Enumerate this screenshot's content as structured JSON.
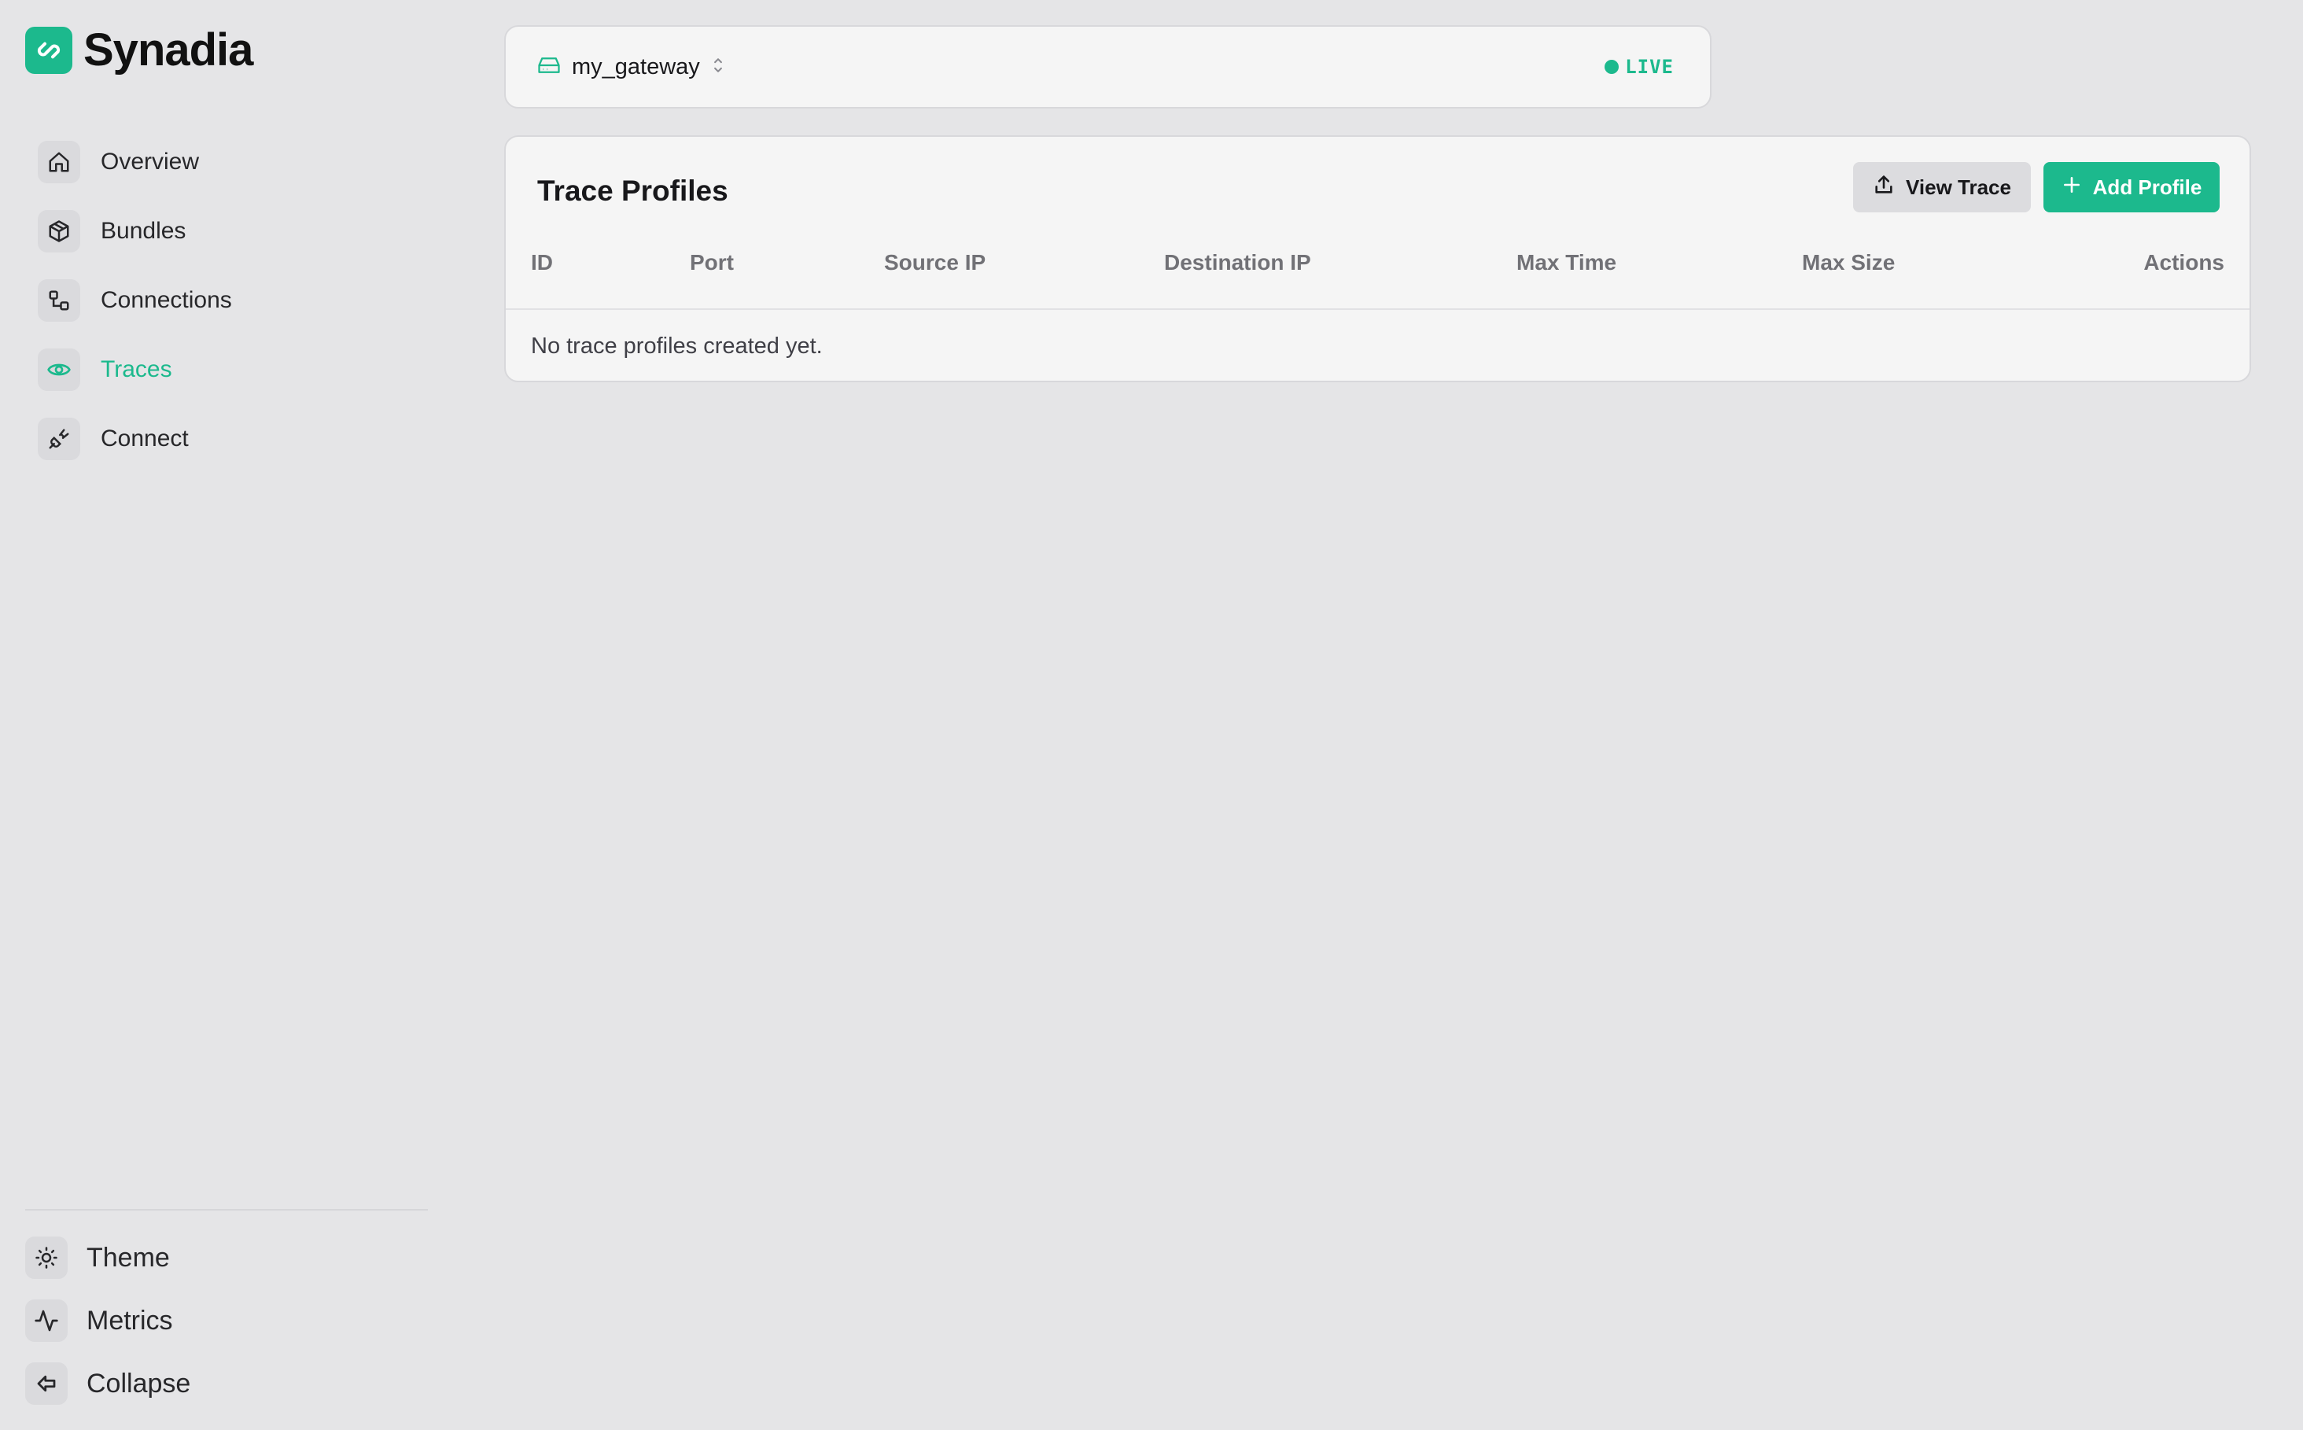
{
  "brand": {
    "name": "Synadia",
    "accent_color": "#1cb98d"
  },
  "sidebar": {
    "items": [
      {
        "label": "Overview",
        "icon": "home-icon",
        "active": false
      },
      {
        "label": "Bundles",
        "icon": "box-icon",
        "active": false
      },
      {
        "label": "Connections",
        "icon": "connections-icon",
        "active": false
      },
      {
        "label": "Traces",
        "icon": "eye-icon",
        "active": true
      },
      {
        "label": "Connect",
        "icon": "plug-icon",
        "active": false
      }
    ],
    "utilities": [
      {
        "label": "Theme",
        "icon": "sun-icon"
      },
      {
        "label": "Metrics",
        "icon": "activity-icon"
      },
      {
        "label": "Collapse",
        "icon": "collapse-icon"
      }
    ]
  },
  "gateway": {
    "name": "my_gateway",
    "icon": "hard-drive-icon",
    "status": "LIVE",
    "status_color": "#1cb98d"
  },
  "traces": {
    "title": "Trace Profiles",
    "view_button": "View Trace",
    "add_button": "Add Profile",
    "columns": [
      "ID",
      "Port",
      "Source IP",
      "Destination IP",
      "Max Time",
      "Max Size",
      "Actions"
    ],
    "empty_message": "No trace profiles created yet."
  }
}
